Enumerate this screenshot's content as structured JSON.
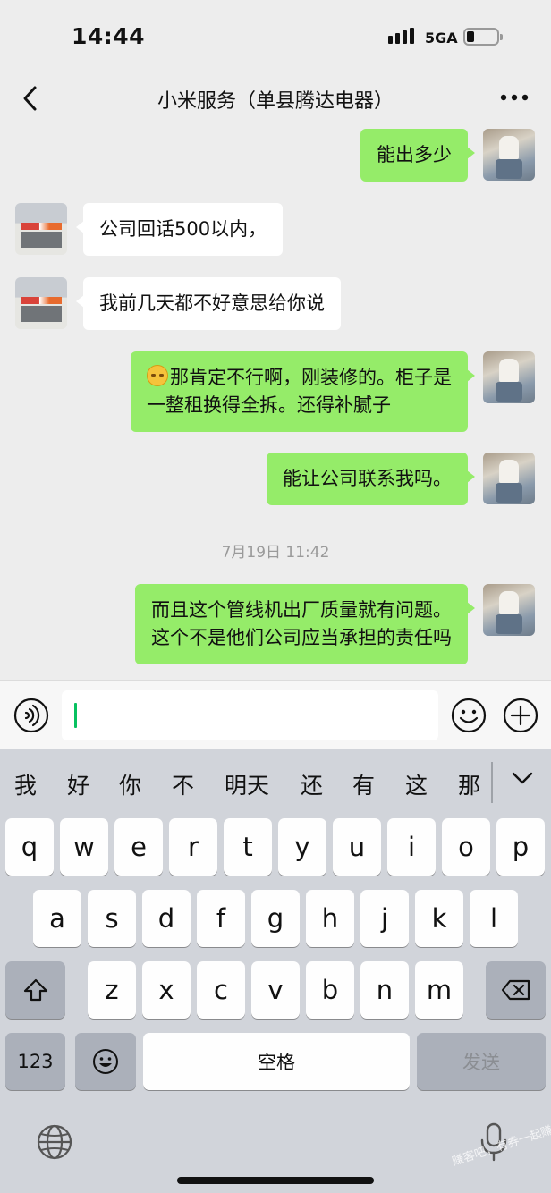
{
  "status_bar": {
    "time": "14:44",
    "network": "5GA"
  },
  "header": {
    "title": "小米服务（单县腾达电器）"
  },
  "messages": [
    {
      "side": "sent",
      "text": "能出多少"
    },
    {
      "side": "received",
      "text": "公司回话500以内，"
    },
    {
      "side": "received",
      "text": "我前几天都不好意思给你说"
    },
    {
      "side": "sent",
      "line1": "那肯定不行啊，刚装修的。柜子是",
      "line2": "一整租换得全拆。还得补腻子"
    },
    {
      "side": "sent",
      "text": "能让公司联系我吗。"
    },
    {
      "type": "timestamp",
      "text": "7月19日 11:42"
    },
    {
      "side": "sent",
      "line1": "而且这个管线机出厂质量就有问题。",
      "line2": "这个不是他们公司应当承担的责任吗"
    }
  ],
  "keyboard": {
    "candidates": [
      "我",
      "好",
      "你",
      "不",
      "明天",
      "还",
      "有",
      "这",
      "那"
    ],
    "row1": [
      "q",
      "w",
      "e",
      "r",
      "t",
      "y",
      "u",
      "i",
      "o",
      "p"
    ],
    "row2": [
      "a",
      "s",
      "d",
      "f",
      "g",
      "h",
      "j",
      "k",
      "l"
    ],
    "row3": [
      "z",
      "x",
      "c",
      "v",
      "b",
      "n",
      "m"
    ],
    "numbers_label": "123",
    "space_label": "空格",
    "send_label": "发送"
  },
  "watermark": "赚客吧，有券一起赚！ www.zuanke8"
}
